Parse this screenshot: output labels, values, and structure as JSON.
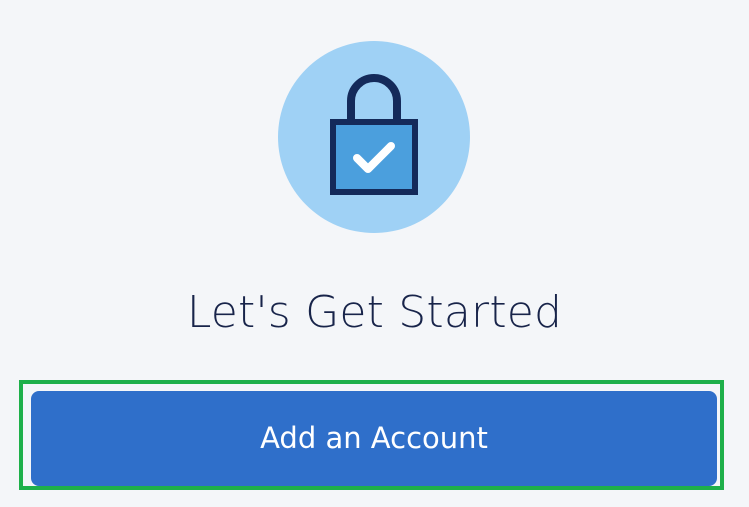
{
  "hero": {
    "icon": "lock-check-icon",
    "circle_color": "#9fd1f5",
    "lock_fill": "#4b9fdd",
    "lock_outline": "#142a5a",
    "check_color": "#ffffff"
  },
  "heading": {
    "title": "Let's Get Started"
  },
  "actions": {
    "primary_label": "Add an Account",
    "primary_color": "#2f6fca",
    "focus_color": "#1eb04a"
  }
}
